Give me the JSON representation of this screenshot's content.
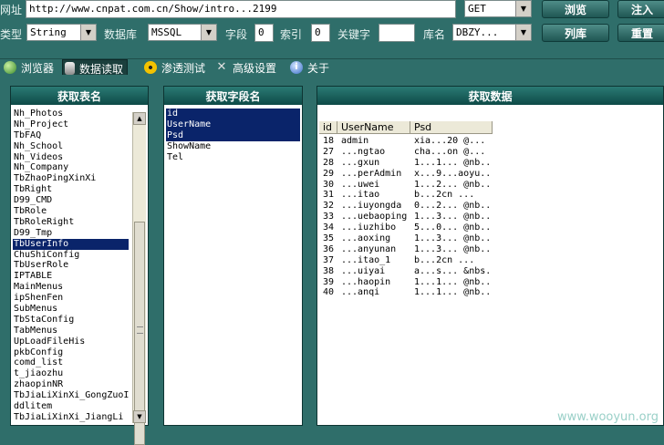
{
  "toolbar": {
    "url_label": "网址",
    "url_value": "http://www.cnpat.com.cn/Show/intro...2199",
    "method": "GET",
    "browse_label": "浏览",
    "inject_label": "注入",
    "type_label": "类型",
    "type_value": "String",
    "db_label": "数据库",
    "db_value": "MSSQL",
    "field_label": "字段",
    "field_value": "0",
    "index_label": "索引",
    "index_value": "0",
    "keyword_label": "关键字",
    "keyword_value": "",
    "dbname_label": "库名",
    "dbname_value": "DBZY...",
    "listdb_label": "列库",
    "reset_label": "重置"
  },
  "tabs": [
    {
      "label": "浏览器",
      "icon": "globe-icon"
    },
    {
      "label": "数据读取",
      "icon": "database-icon",
      "active": true
    },
    {
      "label": "渗透测试",
      "icon": "radiation-icon"
    },
    {
      "label": "高级设置",
      "icon": "tools-icon"
    },
    {
      "label": "关于",
      "icon": "info-icon"
    }
  ],
  "tables_panel": {
    "title": "获取表名",
    "items": [
      "Nh_Photos",
      "Nh_Project",
      "TbFAQ",
      "Nh_School",
      "Nh_Videos",
      "Nh_Company",
      "TbZhaoPingXinXi",
      "TbRight",
      "D99_CMD",
      "TbRole",
      "TbRoleRight",
      "D99_Tmp",
      "TbUserInfo",
      "ChuShiConfig",
      "TbUserRole",
      "IPTABLE",
      "MainMenus",
      "ipShenFen",
      "SubMenus",
      "TbStaConfig",
      "TabMenus",
      "UpLoadFileHis",
      "pkbConfig",
      "comd_list",
      "t_jiaozhu",
      "zhaopinNR",
      "TbJiaLiXinXi_GongZuoI",
      "ddlitem",
      "TbJiaLiXinXi_JiangLi"
    ],
    "selected_index": 12
  },
  "fields_panel": {
    "title": "获取字段名",
    "items": [
      "id",
      "UserName",
      "Psd",
      "ShowName",
      "Tel"
    ],
    "selected": [
      0,
      1,
      2
    ]
  },
  "data_panel": {
    "title": "获取数据",
    "columns": [
      "id",
      "UserName",
      "Psd"
    ],
    "rows": [
      [
        "18",
        "admin",
        "xia...20 @..."
      ],
      [
        "27",
        "...ngtao",
        "cha...on @..."
      ],
      [
        "28",
        "...gxun",
        "1...1... @nb..."
      ],
      [
        "29",
        "...perAdmin",
        "x...9...aoyu..."
      ],
      [
        "30",
        "...uwei",
        "1...2... @nb..."
      ],
      [
        "31",
        "...itao",
        "b...2cn ..."
      ],
      [
        "32",
        "...iuyongda",
        "0...2... @nb..."
      ],
      [
        "33",
        "...uebaoping",
        "1...3... @nb..."
      ],
      [
        "34",
        "...iuzhibo",
        "5...0... @nb..."
      ],
      [
        "35",
        "...aoxing",
        "1...3... @nb..."
      ],
      [
        "36",
        "...anyunan",
        "1...3... @nb..."
      ],
      [
        "37",
        "...itao_1",
        "b...2cn ..."
      ],
      [
        "38",
        "...uiyai",
        "a...s... &nbs..."
      ],
      [
        "39",
        "...haopin",
        "1...1... @nb..."
      ],
      [
        "40",
        "...anqi",
        "1...1... @nb..."
      ]
    ]
  },
  "watermark": "www.wooyun.org",
  "colors": {
    "bg": "#2f6e6a",
    "header": "#0e4a47",
    "selection": "#0a246a"
  }
}
